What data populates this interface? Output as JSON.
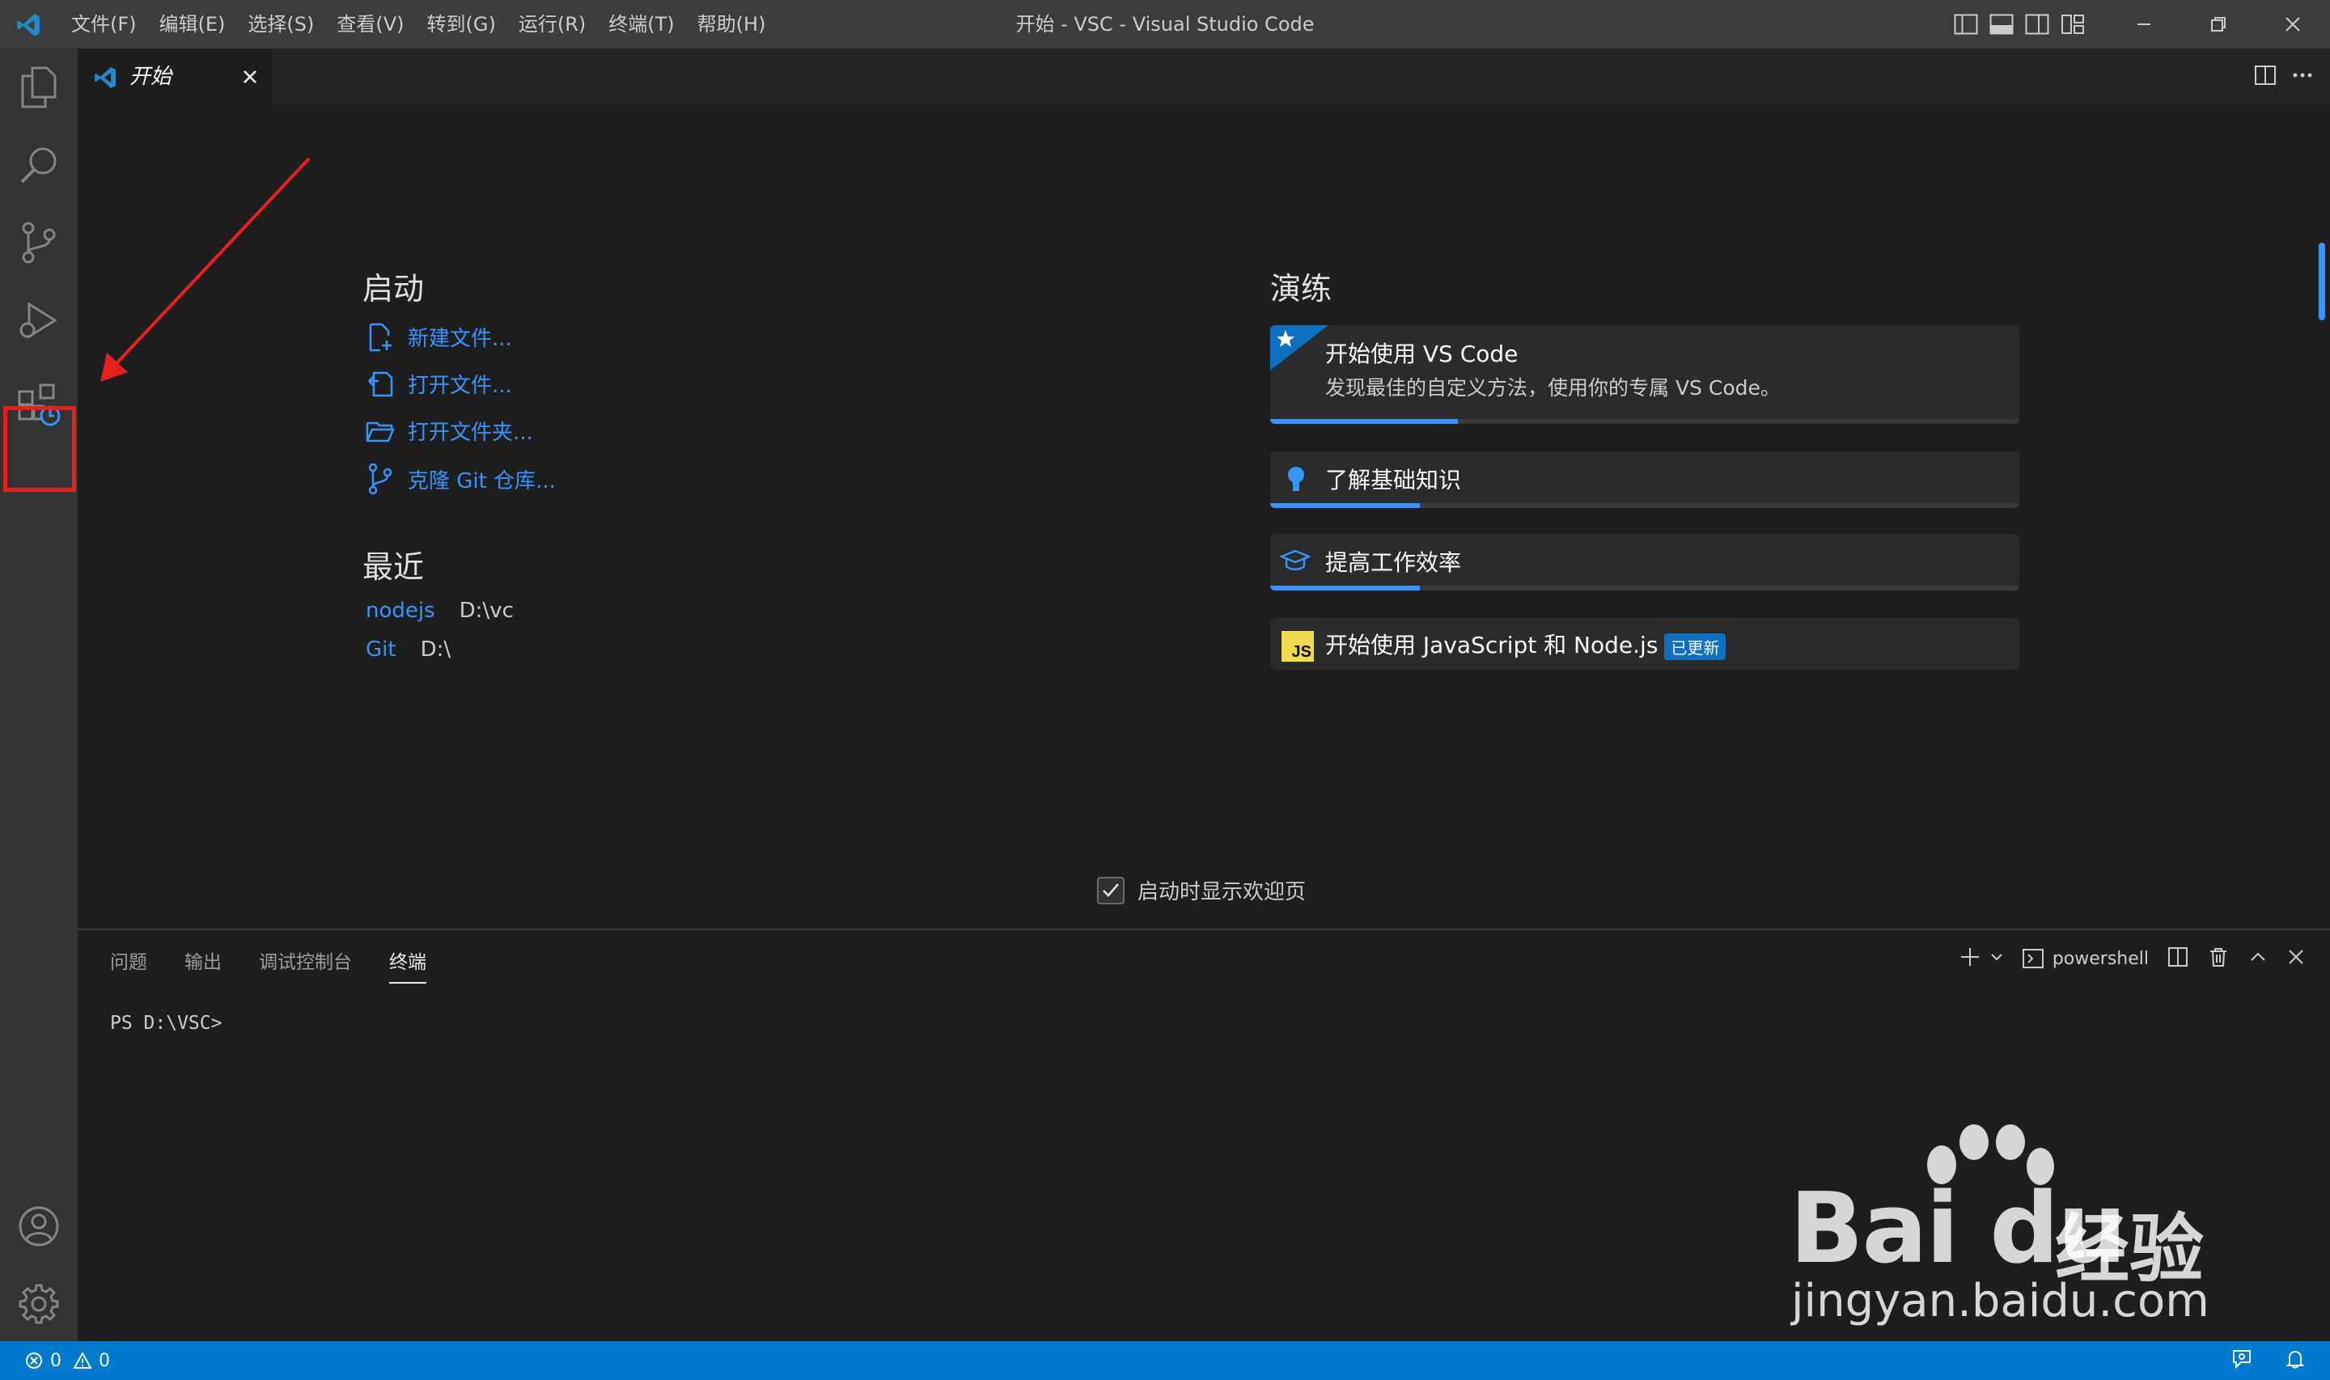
{
  "titlebar": {
    "menu": [
      "文件(F)",
      "编辑(E)",
      "选择(S)",
      "查看(V)",
      "转到(G)",
      "运行(R)",
      "终端(T)",
      "帮助(H)"
    ],
    "title": "开始 - VSC - Visual Studio Code"
  },
  "tab": {
    "label": "开始"
  },
  "start": {
    "heading": "启动",
    "links": [
      "新建文件...",
      "打开文件...",
      "打开文件夹...",
      "克隆 Git 仓库..."
    ]
  },
  "recent": {
    "heading": "最近",
    "items": [
      {
        "name": "nodejs",
        "path": "D:\\vc"
      },
      {
        "name": "Git",
        "path": "D:\\"
      }
    ]
  },
  "walkthroughs": {
    "heading": "演练",
    "items": [
      {
        "title": "开始使用 VS Code",
        "description": "发现最佳的自定义方法，使用你的专属 VS Code。",
        "progress": 0.25
      },
      {
        "title": "了解基础知识",
        "progress": 0.2
      },
      {
        "title": "提高工作效率",
        "progress": 0.2
      },
      {
        "title": "开始使用 JavaScript 和 Node.js",
        "badge": "已更新",
        "icon_text": "JS"
      }
    ]
  },
  "welcome_checkbox": {
    "label": "启动时显示欢迎页",
    "checked": true
  },
  "panel": {
    "tabs": [
      "问题",
      "输出",
      "调试控制台",
      "终端"
    ],
    "active_tab": "终端",
    "terminal_name": "powershell",
    "prompt": "PS D:\\VSC>"
  },
  "statusbar": {
    "errors": "0",
    "warnings": "0"
  },
  "watermark": {
    "brand": "Bai du",
    "cn": "经验",
    "url": "jingyan.baidu.com"
  },
  "colors": {
    "accent": "#007acc",
    "link": "#3794ff",
    "highlight": "#e81f1f",
    "js_yellow": "#f0db4f"
  }
}
